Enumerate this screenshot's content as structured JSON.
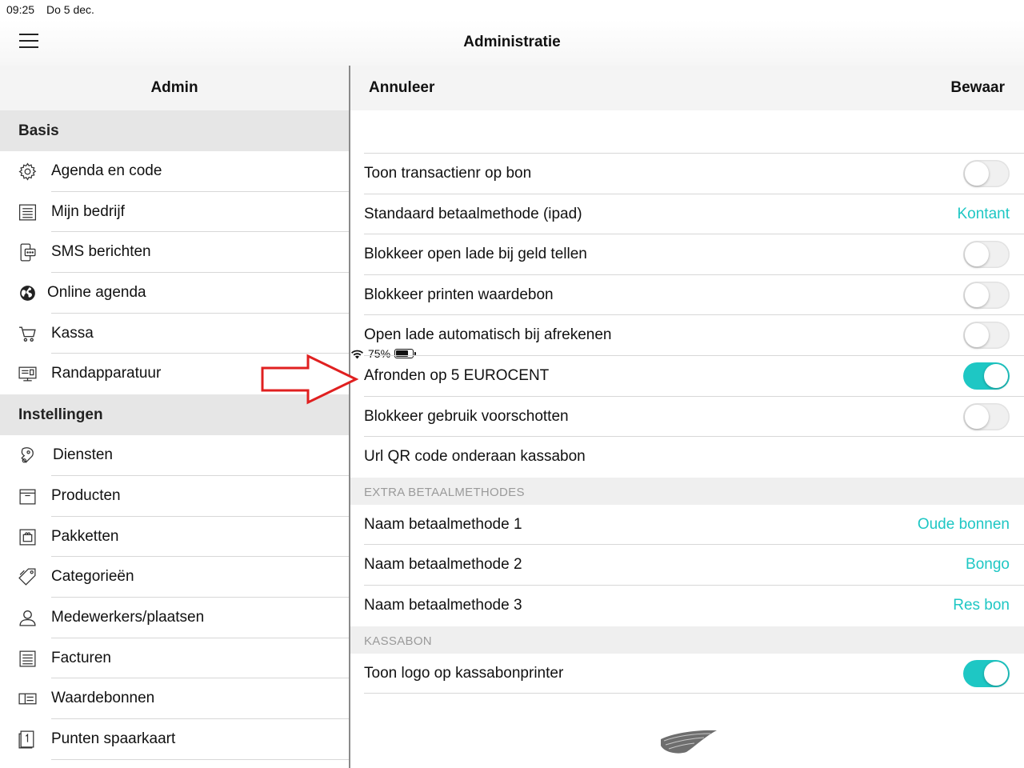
{
  "status": {
    "time": "09:25",
    "date": "Do 5 dec.",
    "battery": "75%",
    "battery_level": 0.75
  },
  "nav": {
    "title": "Administratie",
    "menu_icon": "hamburger-icon"
  },
  "left": {
    "title": "Admin",
    "sections": [
      {
        "title": "Basis",
        "items": [
          {
            "label": "Agenda en code",
            "icon": "gear-icon"
          },
          {
            "label": "Mijn bedrijf",
            "icon": "list-icon"
          },
          {
            "label": "SMS berichten",
            "icon": "phone-message-icon"
          },
          {
            "label": "Online agenda",
            "icon": "globe-icon"
          },
          {
            "label": "Kassa",
            "icon": "cart-icon"
          },
          {
            "label": "Randapparatuur",
            "icon": "devices-icon"
          }
        ]
      },
      {
        "title": "Instellingen",
        "items": [
          {
            "label": "Diensten",
            "icon": "scissors-hand-icon"
          },
          {
            "label": "Producten",
            "icon": "box-icon"
          },
          {
            "label": "Pakketten",
            "icon": "package-icon"
          },
          {
            "label": "Categorieën",
            "icon": "tags-icon"
          },
          {
            "label": "Medewerkers/plaatsen",
            "icon": "person-icon"
          },
          {
            "label": "Facturen",
            "icon": "invoice-icon"
          },
          {
            "label": "Waardebonnen",
            "icon": "voucher-icon"
          },
          {
            "label": "Punten spaarkaart",
            "icon": "loyalty-card-icon"
          }
        ]
      }
    ]
  },
  "right": {
    "cancel": "Annuleer",
    "save": "Bewaar",
    "rows": [
      {
        "label": "Toon transactienr op bon",
        "toggle": false
      },
      {
        "label": "Standaard betaalmethode (ipad)",
        "value": "Kontant"
      },
      {
        "label": "Blokkeer open lade bij geld tellen",
        "toggle": false
      },
      {
        "label": "Blokkeer printen waardebon",
        "toggle": false
      },
      {
        "label": "Open lade automatisch bij afrekenen",
        "toggle": false
      },
      {
        "label": "Afronden op 5 EUROCENT",
        "toggle": true
      },
      {
        "label": "Blokkeer gebruik voorschotten",
        "toggle": false
      },
      {
        "label": "Url QR code onderaan kassabon"
      }
    ],
    "extra_header": "EXTRA BETAALMETHODES",
    "extra_rows": [
      {
        "label": "Naam betaalmethode 1",
        "value": "Oude bonnen"
      },
      {
        "label": "Naam betaalmethode 2",
        "value": "Bongo"
      },
      {
        "label": "Naam betaalmethode 3",
        "value": "Res bon"
      }
    ],
    "kassabon_header": "KASSABON",
    "kassabon_rows": [
      {
        "label": "Toon logo op kassabonprinter",
        "toggle": true
      }
    ]
  },
  "colors": {
    "accent": "#1ec7c4",
    "annotation_arrow": "#e02020"
  }
}
